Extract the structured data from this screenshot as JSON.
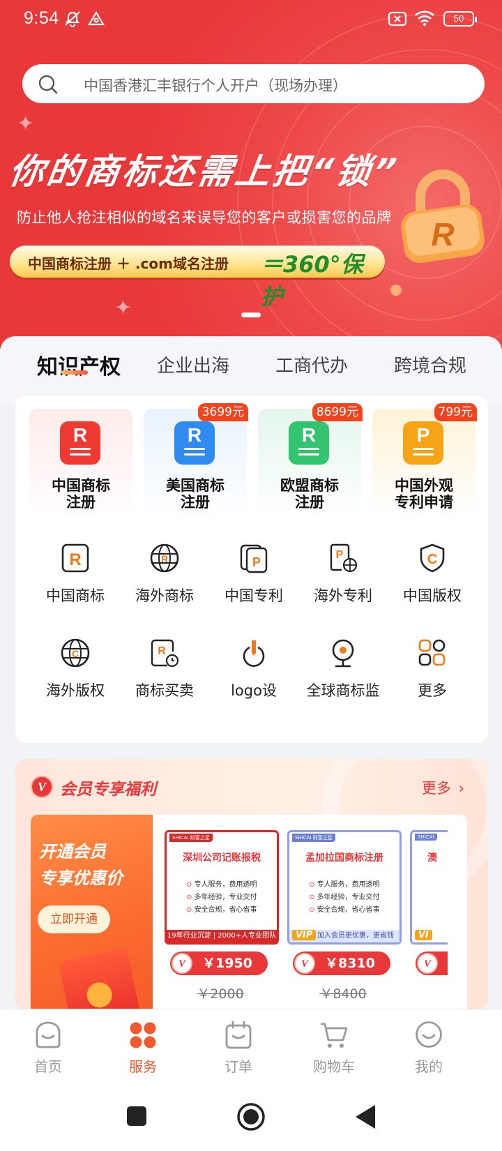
{
  "status": {
    "time": "9:54",
    "battery": "50"
  },
  "search": {
    "placeholder": "中国香港汇丰银行个人开户（现场办理）"
  },
  "banner": {
    "title": "你的商标还需上把“锁”",
    "subtitle": "防止他人抢注相似的域名来误导您的客户或损害您的品牌",
    "pill_left": "中国商标注册 ＋ .com域名注册",
    "pill_right": "＝360°保护",
    "lock_letter": "R"
  },
  "tabs": [
    {
      "label": "知识产权",
      "active": true
    },
    {
      "label": "企业出海"
    },
    {
      "label": "工商代办"
    },
    {
      "label": "跨境合规"
    }
  ],
  "featured": [
    {
      "label": "中国商标\n注册",
      "letter": "R",
      "color": "#ee3a32",
      "bg": "#fff0ee",
      "price": ""
    },
    {
      "label": "美国商标\n注册",
      "letter": "R",
      "color": "#2f8bef",
      "bg": "#ecf5fe",
      "price": "3699元"
    },
    {
      "label": "欧盟商标\n注册",
      "letter": "R",
      "color": "#33c46f",
      "bg": "#eaf8ef",
      "price": "8699元"
    },
    {
      "label": "中国外观\n专利申请",
      "letter": "P",
      "color": "#f6a415",
      "bg": "#fff6e1",
      "price": "799元"
    }
  ],
  "grid": [
    {
      "label": "中国商标",
      "icon": "trademark-r-icon"
    },
    {
      "label": "海外商标",
      "icon": "globe-r-icon"
    },
    {
      "label": "中国专利",
      "icon": "patent-p-icon"
    },
    {
      "label": "海外专利",
      "icon": "patent-globe-icon"
    },
    {
      "label": "中国版权",
      "icon": "copyright-shield-icon"
    },
    {
      "label": "海外版权",
      "icon": "globe-c-icon"
    },
    {
      "label": "商标买卖",
      "icon": "trademark-clock-icon"
    },
    {
      "label": "logo设",
      "icon": "pen-nib-icon"
    },
    {
      "label": "全球商标监",
      "icon": "monitor-camera-icon"
    },
    {
      "label": "更多",
      "icon": "more-apps-icon"
    }
  ],
  "member": {
    "title": "会员专享福利",
    "more": "更多",
    "badge": "V",
    "promo_title_1": "开通会员",
    "promo_title_2": "专享优惠价",
    "promo_button": "立即开通",
    "products": [
      {
        "title": "深圳公司记账报税",
        "tag": "SHICAI 财富之星",
        "lines": [
          "专人服务，费用透明",
          "多年经验，专业交付",
          "安全合规，省心省事"
        ],
        "footer": "19年行业沉淀 | 2000+人专业团队",
        "price": "￥1950",
        "orig": "￥2000",
        "style": "red"
      },
      {
        "title": "孟加拉国商标注册",
        "tag": "SHICAI 财富之星",
        "lines": [
          "专人服务，费用透明",
          "多年经验，专业交付",
          "安全合规，省心省事"
        ],
        "footer": "加入会员更优惠，更省钱",
        "vip": "VIP",
        "price": "￥8310",
        "orig": "￥8400",
        "style": "blue"
      },
      {
        "title": "澳",
        "tag": "SHICAI",
        "lines": [],
        "footer": "",
        "vip": "VI",
        "price": "",
        "orig": "",
        "style": "blue"
      }
    ]
  },
  "nav": [
    {
      "label": "首页",
      "icon": "home-icon"
    },
    {
      "label": "服务",
      "icon": "services-icon",
      "active": true
    },
    {
      "label": "订单",
      "icon": "orders-icon"
    },
    {
      "label": "购物车",
      "icon": "cart-icon"
    },
    {
      "label": "我的",
      "icon": "profile-icon"
    }
  ],
  "colors": {
    "brand_red": "#e8383a",
    "accent_orange": "#ef5a2f"
  }
}
